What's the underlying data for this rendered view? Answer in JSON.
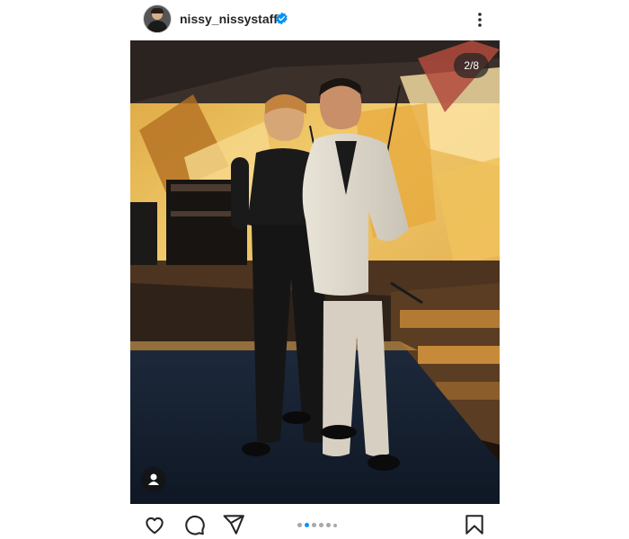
{
  "header": {
    "username": "nissy_nissystaff",
    "verified_icon": "verified-badge-icon",
    "more_icon": "more-vertical-icon"
  },
  "post": {
    "image_counter": "2/8",
    "current_image": 2,
    "total_images": 8
  },
  "actions": {
    "like_icon": "heart-icon",
    "comment_icon": "comment-icon",
    "share_icon": "send-icon",
    "save_icon": "bookmark-icon"
  },
  "colors": {
    "verified": "#0095f6",
    "active_dot": "#0095f6",
    "inactive_dot": "#a8a8a8"
  }
}
